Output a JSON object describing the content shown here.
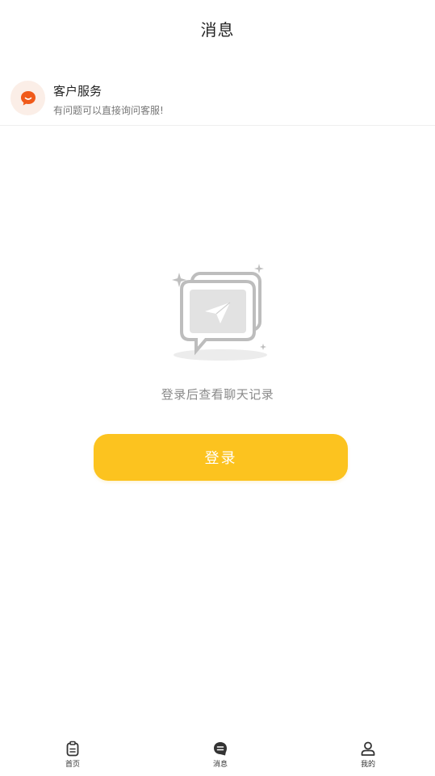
{
  "header": {
    "title": "消息"
  },
  "service": {
    "name": "客户服务",
    "description": "有问题可以直接询问客服!",
    "icon": "chat-bubble-icon",
    "icon_color": "#f05a1a"
  },
  "empty_state": {
    "icon": "message-box-paper-plane-icon",
    "text": "登录后查看聊天记录"
  },
  "login_button": {
    "label": "登录",
    "color": "#fcc31f"
  },
  "tabbar": {
    "items": [
      {
        "label": "首页",
        "icon": "home-clipboard-icon"
      },
      {
        "label": "消息",
        "icon": "message-icon",
        "active": true
      },
      {
        "label": "我的",
        "icon": "user-icon"
      }
    ]
  }
}
